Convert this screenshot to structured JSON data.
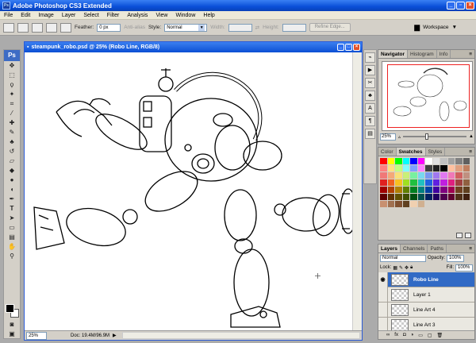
{
  "app": {
    "title": "Adobe Photoshop CS3 Extended",
    "logo": "Ps"
  },
  "menu": [
    "File",
    "Edit",
    "Image",
    "Layer",
    "Select",
    "Filter",
    "Analysis",
    "View",
    "Window",
    "Help"
  ],
  "options": {
    "feather_label": "Feather:",
    "feather_value": "0 px",
    "antialias_label": "Anti-alias",
    "style_label": "Style:",
    "style_value": "Normal",
    "width_label": "Width:",
    "height_label": "Height:",
    "refine_label": "Refine Edge...",
    "workspace_label": "Workspace"
  },
  "document": {
    "title": "steampunk_robo.psd @ 25% (Robo Line, RGB/8)",
    "zoom": "25%",
    "doc_info": "Doc: 19.4M/96.9M"
  },
  "navigator": {
    "tabs": [
      "Navigator",
      "Histogram",
      "Info"
    ],
    "zoom": "25%"
  },
  "swatches_panel": {
    "tabs": [
      "Color",
      "Swatches",
      "Styles"
    ]
  },
  "swatch_colors": [
    [
      "#ff0000",
      "#ffff00",
      "#00ff00",
      "#00ffff",
      "#0000ff",
      "#ff00ff",
      "#ffffff",
      "#e0e0e0",
      "#c0c0c0",
      "#a0a0a0",
      "#808080",
      "#606060"
    ],
    [
      "#ff8080",
      "#ffe080",
      "#c0ff80",
      "#80ffff",
      "#80a0ff",
      "#ff80ff",
      "#404040",
      "#202020",
      "#000000",
      "#ffc0a0",
      "#e0a080",
      "#c08060"
    ],
    [
      "#f07878",
      "#f4a878",
      "#f8e078",
      "#c8f078",
      "#78f0a0",
      "#78d8f0",
      "#7898f0",
      "#a078f0",
      "#e078f0",
      "#f078b8",
      "#d06060",
      "#c09080"
    ],
    [
      "#e02020",
      "#f06020",
      "#f8c020",
      "#a0e020",
      "#20c040",
      "#20c0c0",
      "#2060e0",
      "#6020e0",
      "#c020e0",
      "#e02080",
      "#a04040",
      "#906040"
    ],
    [
      "#a00000",
      "#b04000",
      "#b08000",
      "#608000",
      "#008020",
      "#008080",
      "#0040a0",
      "#4000a0",
      "#800080",
      "#a00050",
      "#704020",
      "#604020"
    ],
    [
      "#600000",
      "#603000",
      "#605000",
      "#405000",
      "#005010",
      "#005050",
      "#002060",
      "#200060",
      "#500050",
      "#600030",
      "#503018",
      "#402010"
    ],
    [
      "#c89070",
      "#a07050",
      "#805030",
      "#604020",
      "#f0d0b0",
      "#d0b090",
      "",
      "",
      "",
      "",
      "",
      ""
    ]
  ],
  "layers": {
    "tabs": [
      "Layers",
      "Channels",
      "Paths"
    ],
    "blend_mode": "Normal",
    "opacity_label": "Opacity:",
    "opacity": "100%",
    "lock_label": "Lock:",
    "fill_label": "Fill:",
    "fill": "100%",
    "items": [
      {
        "name": "Robo Line",
        "visible": true,
        "selected": true
      },
      {
        "name": "Layer 1",
        "visible": false,
        "selected": false
      },
      {
        "name": "Line Art 4",
        "visible": false,
        "selected": false
      },
      {
        "name": "Line Art 3",
        "visible": false,
        "selected": false
      }
    ]
  }
}
